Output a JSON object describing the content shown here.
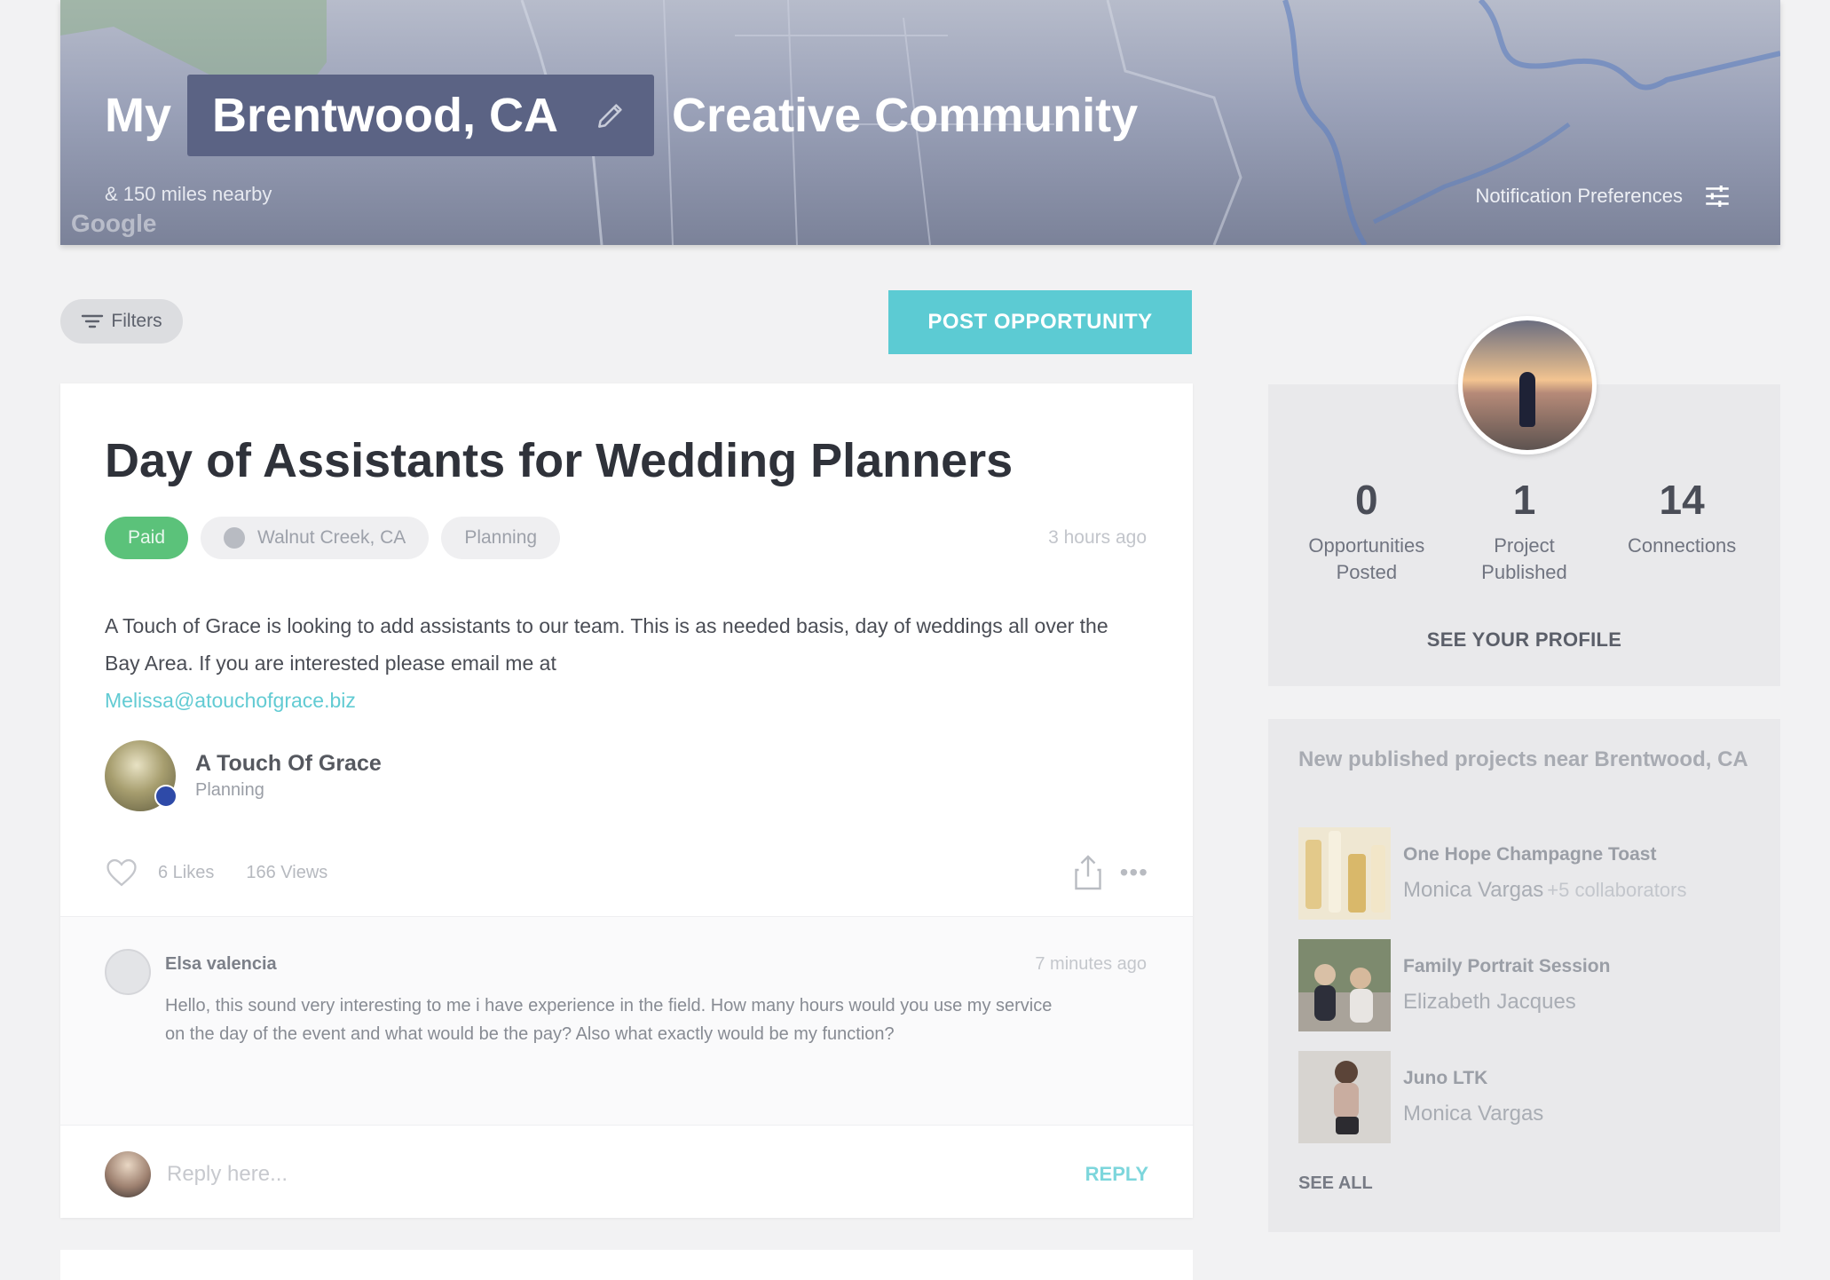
{
  "hero": {
    "my": "My",
    "city": "Brentwood, CA",
    "suffix": "Creative Community",
    "nearby": "& 150 miles nearby",
    "map_credit": "Google",
    "notification_label": "Notification Preferences"
  },
  "actions": {
    "filters_label": "Filters",
    "post_label": "POST OPPORTUNITY"
  },
  "post": {
    "title": "Day of Assistants for Wedding Planners",
    "tags": {
      "paid": "Paid",
      "location": "Walnut Creek, CA",
      "category": "Planning"
    },
    "time": "3 hours ago",
    "body": "A Touch of Grace is looking to add assistants to our team. This is as needed basis, day of weddings all over the Bay Area. If you are interested please email me at",
    "email": "Melissa@atouchofgrace.biz",
    "author": {
      "name": "A Touch Of Grace",
      "category": "Planning"
    },
    "likes": "6 Likes",
    "views": "166 Views",
    "more": "•••"
  },
  "comment": {
    "name": "Elsa valencia",
    "time": "7 minutes ago",
    "text": "Hello, this sound very interesting to me i have experience in the field. How many hours would you use my service on the day of the event and what would be the pay? Also what exactly would be my function?"
  },
  "reply": {
    "placeholder": "Reply here...",
    "button": "REPLY"
  },
  "profile": {
    "stats": [
      {
        "num": "0",
        "label": "Opportunities Posted"
      },
      {
        "num": "1",
        "label": "Project Published"
      },
      {
        "num": "14",
        "label": "Connections"
      }
    ],
    "see_profile": "SEE YOUR PROFILE"
  },
  "projects": {
    "heading": "New published projects near Brentwood, CA",
    "items": [
      {
        "title": "One Hope Champagne Toast",
        "author": "Monica Vargas",
        "collab": "+5 collaborators"
      },
      {
        "title": "Family Portrait Session",
        "author": "Elizabeth Jacques",
        "collab": ""
      },
      {
        "title": "Juno LTK",
        "author": "Monica Vargas",
        "collab": ""
      }
    ],
    "see_all": "SEE ALL"
  },
  "colors": {
    "accent": "#5ccbd3",
    "paid_tag": "#5bc27a",
    "hero_city_box": "#5b6384"
  }
}
